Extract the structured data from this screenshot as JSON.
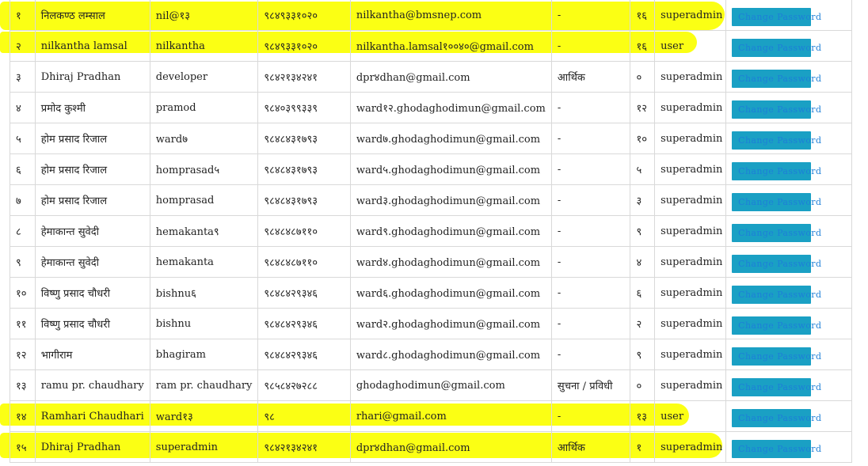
{
  "highlight_color": "#fbff00",
  "button_color": "#1aa0c4",
  "rows": [
    {
      "sn": "१",
      "name": "निलकण्ठ लम्साल",
      "username": "nil@१३",
      "phone": "९८४९३३१०२०",
      "email": "nilkantha@bmsnep.com",
      "department": "-",
      "ward": "१६",
      "role": "superadmin",
      "action": "Change Password"
    },
    {
      "sn": "२",
      "name": "nilkantha lamsal",
      "username": "nilkantha",
      "phone": "९८४९३३१०२०",
      "email": "nilkantha.lamsal१००४०@gmail.com",
      "department": "-",
      "ward": "१६",
      "role": "user",
      "action": "Change Password"
    },
    {
      "sn": "३",
      "name": "Dhiraj Pradhan",
      "username": "developer",
      "phone": "९८४२१३४२४१",
      "email": "dpr४dhan@gmail.com",
      "department": "आर्थिक",
      "ward": "०",
      "role": "superadmin",
      "action": "Change Password"
    },
    {
      "sn": "४",
      "name": "प्रमोद कुश्मी",
      "username": "pramod",
      "phone": "९८४०३९९३३९",
      "email": "ward१२.ghodaghodimun@gmail.com",
      "department": "-",
      "ward": "१२",
      "role": "superadmin",
      "action": "Change Password"
    },
    {
      "sn": "५",
      "name": "होम प्रसाद रिजाल",
      "username": "ward७",
      "phone": "९८४८४३१७९३",
      "email": "ward७.ghodaghodimun@gmail.com",
      "department": "-",
      "ward": "१०",
      "role": "superadmin",
      "action": "Change Password"
    },
    {
      "sn": "६",
      "name": "होम प्रसाद रिजाल",
      "username": "homprasad५",
      "phone": "९८४८४३१७९३",
      "email": "ward५.ghodaghodimun@gmail.com",
      "department": "-",
      "ward": "५",
      "role": "superadmin",
      "action": "Change Password"
    },
    {
      "sn": "७",
      "name": "होम प्रसाद रिजाल",
      "username": "homprasad",
      "phone": "९८४८४३१७९३",
      "email": "ward३.ghodaghodimun@gmail.com",
      "department": "-",
      "ward": "३",
      "role": "superadmin",
      "action": "Change Password"
    },
    {
      "sn": "८",
      "name": "हेमाकान्त सुवेदी",
      "username": "hemakanta९",
      "phone": "९८४८४८७११०",
      "email": "ward९.ghodaghodimun@gmail.com",
      "department": "-",
      "ward": "९",
      "role": "superadmin",
      "action": "Change Password"
    },
    {
      "sn": "९",
      "name": "हेमाकान्त सुवेदी",
      "username": "hemakanta",
      "phone": "९८४८४८७११०",
      "email": "ward४.ghodaghodimun@gmail.com",
      "department": "-",
      "ward": "४",
      "role": "superadmin",
      "action": "Change Password"
    },
    {
      "sn": "१०",
      "name": "विष्णु प्रसाद चौधरी",
      "username": "bishnu६",
      "phone": "९८४८४२९३४६",
      "email": "ward६.ghodaghodimun@gmail.com",
      "department": "-",
      "ward": "६",
      "role": "superadmin",
      "action": "Change Password"
    },
    {
      "sn": "११",
      "name": "विष्णु प्रसाद चौधरी",
      "username": "bishnu",
      "phone": "९८४८४२९३४६",
      "email": "ward२.ghodaghodimun@gmail.com",
      "department": "-",
      "ward": "२",
      "role": "superadmin",
      "action": "Change Password"
    },
    {
      "sn": "१२",
      "name": "भागीराम",
      "username": "bhagiram",
      "phone": "९८४८४२९३४६",
      "email": "ward८.ghodaghodimun@gmail.com",
      "department": "-",
      "ward": "९",
      "role": "superadmin",
      "action": "Change Password"
    },
    {
      "sn": "१३",
      "name": "ramu pr. chaudhary",
      "username": "ram pr. chaudhary",
      "phone": "९८५८४२७२८८",
      "email": "ghodaghodimun@gmail.com",
      "department": "सुचना / प्रविधी",
      "ward": "०",
      "role": "superadmin",
      "action": "Change Password"
    },
    {
      "sn": "१४",
      "name": "Ramhari Chaudhari",
      "username": "ward१३",
      "phone": "९८",
      "email": "rhari@gmail.com",
      "department": "-",
      "ward": "१३",
      "role": "user",
      "action": "Change Password"
    },
    {
      "sn": "१५",
      "name": "Dhiraj Pradhan",
      "username": "superadmin",
      "phone": "९८४२१३४२४१",
      "email": "dpr४dhan@gmail.com",
      "department": "आर्थिक",
      "ward": "१",
      "role": "superadmin",
      "action": "Change Password"
    }
  ]
}
